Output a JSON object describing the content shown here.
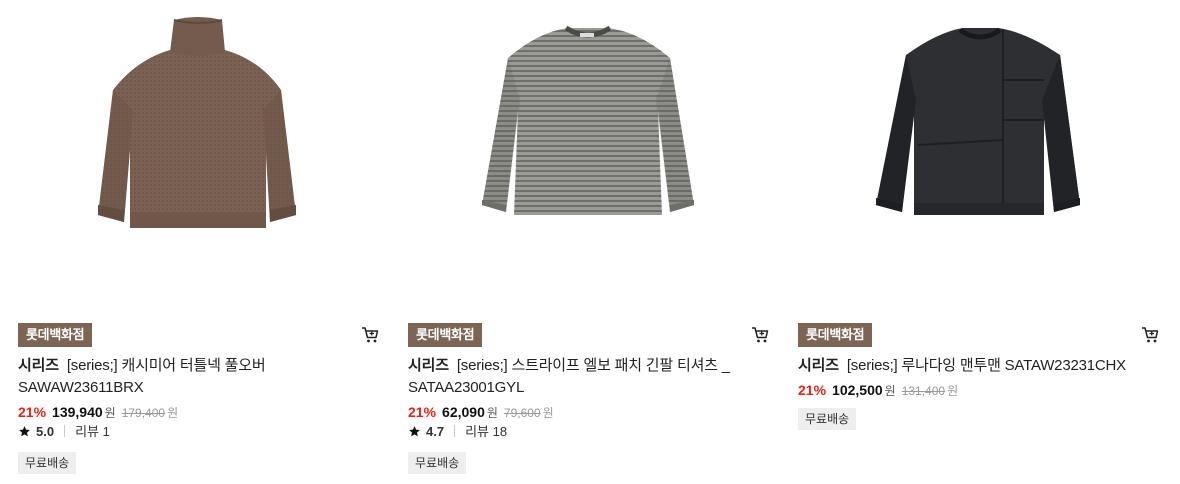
{
  "products": [
    {
      "store_badge": "롯데백화점",
      "brand": "시리즈",
      "name": "[series;] 캐시미어 터틀넥 풀오버 SAWAW23611BRX",
      "discount": "21%",
      "price": "139,940",
      "price_unit": "원",
      "original_price": "179,400",
      "original_unit": "원",
      "rating": "5.0",
      "review": "리뷰 1",
      "shipping": "무료배송",
      "image_icon": "turtleneck-sweater-image",
      "image_color": "#7a6253"
    },
    {
      "store_badge": "롯데백화점",
      "brand": "시리즈",
      "name": "[series;] 스트라이프 엘보 패치 긴팔 티셔츠 _ SATAA23001GYL",
      "discount": "21%",
      "price": "62,090",
      "price_unit": "원",
      "original_price": "79,600",
      "original_unit": "원",
      "rating": "4.7",
      "review": "리뷰 18",
      "shipping": "무료배송",
      "image_icon": "striped-tshirt-image",
      "image_color": "#8a8a86"
    },
    {
      "store_badge": "롯데백화점",
      "brand": "시리즈",
      "name": "[series;] 루나다잉 맨투맨 SATAW23231CHX",
      "discount": "21%",
      "price": "102,500",
      "price_unit": "원",
      "original_price": "131,400",
      "original_unit": "원",
      "shipping": "무료배송",
      "image_icon": "sweatshirt-image",
      "image_color": "#2e2f33"
    }
  ],
  "icons": {
    "cart": "cart-icon",
    "star": "star-icon"
  },
  "colors": {
    "discount": "#e0251b",
    "store_badge_bg": "#7c6555",
    "shipping_bg": "#eeeeee"
  }
}
